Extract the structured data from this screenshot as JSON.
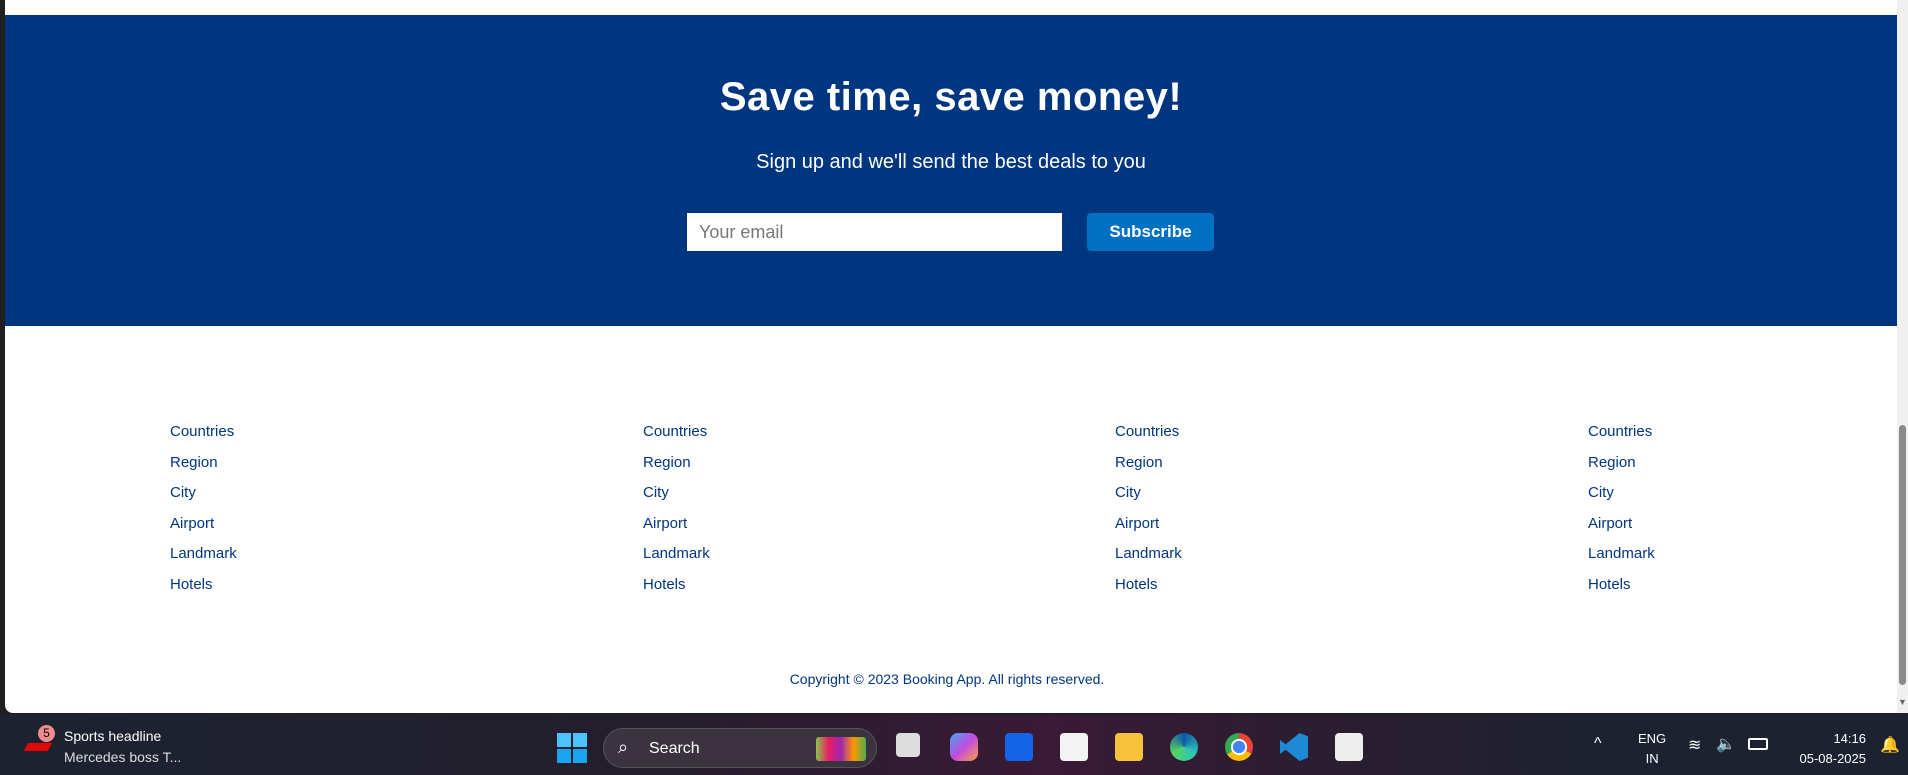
{
  "newsletter": {
    "title": "Save time, save money!",
    "subtitle": "Sign up and we'll send the best deals to you",
    "email_placeholder": "Your email",
    "subscribe_label": "Subscribe"
  },
  "footer": {
    "columns": [
      [
        "Countries",
        "Region",
        "City",
        "Airport",
        "Landmark",
        "Hotels"
      ],
      [
        "Countries",
        "Region",
        "City",
        "Airport",
        "Landmark",
        "Hotels"
      ],
      [
        "Countries",
        "Region",
        "City",
        "Airport",
        "Landmark",
        "Hotels"
      ],
      [
        "Countries",
        "Region",
        "City",
        "Airport",
        "Landmark",
        "Hotels"
      ]
    ],
    "copyright": "Copyright © 2023 Booking App. All rights reserved."
  },
  "taskbar": {
    "news_badge": "5",
    "news_title": "Sports headline",
    "news_sub": "Mercedes boss T...",
    "search_label": "Search",
    "lang_top": "ENG",
    "lang_bottom": "IN",
    "time": "14:16",
    "date": "05-08-2025",
    "apps": [
      "task-view",
      "copilot",
      "app-ai",
      "microsoft-store",
      "file-explorer",
      "edge",
      "chrome",
      "vscode",
      "snipping-tool"
    ]
  }
}
